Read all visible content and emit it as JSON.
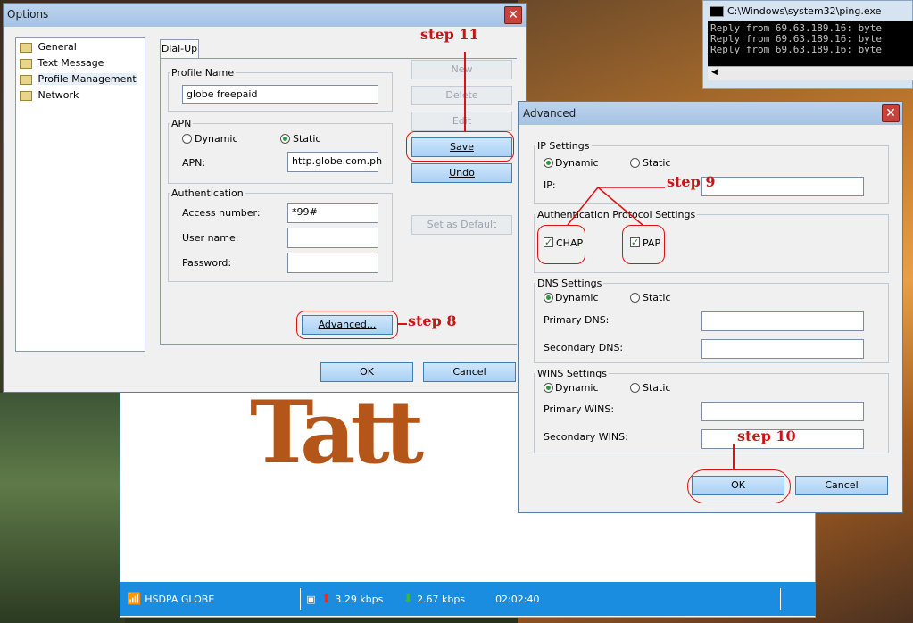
{
  "console": {
    "title": "C:\\Windows\\system32\\ping.exe",
    "lines": [
      "Reply from 69.63.189.16: byte",
      "Reply from 69.63.189.16: byte",
      "Reply from 69.63.189.16: byte"
    ]
  },
  "statusbar": {
    "network": "HSDPA GLOBE",
    "upload": "3.29 kbps",
    "download": "2.67 kbps",
    "timer": "02:02:40"
  },
  "options": {
    "title": "Options",
    "tree": [
      "General",
      "Text Message",
      "Profile Management",
      "Network"
    ],
    "tab": "Dial-Up",
    "profile_name_label": "Profile Name",
    "profile_name_value": "globe freepaid",
    "apn_group": "APN",
    "apn_dynamic": "Dynamic",
    "apn_static": "Static",
    "apn_label": "APN:",
    "apn_value": "http.globe.com.ph",
    "auth_group": "Authentication",
    "access_number_label": "Access number:",
    "access_number_value": "*99#",
    "user_name_label": "User name:",
    "password_label": "Password:",
    "advanced_button": "Advanced...",
    "new_button": "New",
    "delete_button": "Delete",
    "edit_button": "Edit",
    "save_button": "Save",
    "undo_button": "Undo",
    "set_default_button": "Set as Default",
    "ok_button": "OK",
    "cancel_button": "Cancel"
  },
  "advanced": {
    "title": "Advanced",
    "ip_group": "IP Settings",
    "ip_dynamic": "Dynamic",
    "ip_static": "Static",
    "ip_label": "IP:",
    "auth_group": "Authentication Protocol Settings",
    "chap": "CHAP",
    "pap": "PAP",
    "dns_group": "DNS Settings",
    "dns_dynamic": "Dynamic",
    "dns_static": "Static",
    "primary_dns_label": "Primary DNS:",
    "secondary_dns_label": "Secondary DNS:",
    "wins_group": "WINS Settings",
    "wins_dynamic": "Dynamic",
    "wins_static": "Static",
    "primary_wins_label": "Primary WINS:",
    "secondary_wins_label": "Secondary WINS:",
    "ok_button": "OK",
    "cancel_button": "Cancel"
  },
  "annotations": {
    "step8": "step 8",
    "step9": "step 9",
    "step10": "step 10",
    "step11": "step 11"
  },
  "colors": {
    "annotation_red": "#c81414",
    "statusbar_blue": "#1a8de0"
  }
}
